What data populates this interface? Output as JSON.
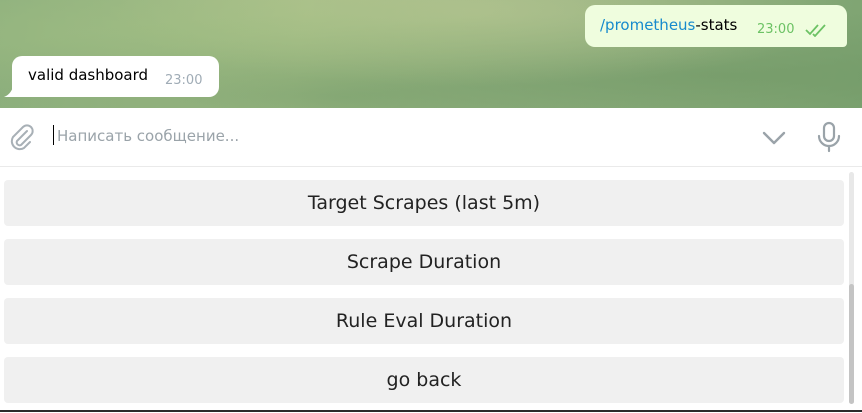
{
  "chat": {
    "outgoing": {
      "command": "/prometheus",
      "suffix": "-stats",
      "time": "23:00",
      "status_icon": "double-check-icon"
    },
    "incoming": {
      "text": "valid dashboard",
      "time": "23:00"
    }
  },
  "composer": {
    "placeholder": "Написать сообщение...",
    "attach_icon": "paperclip-icon",
    "keyboard_toggle_icon": "chevron-down-icon",
    "voice_icon": "microphone-icon"
  },
  "keyboard": {
    "buttons": [
      {
        "label": "Target Scrapes (last 5m)"
      },
      {
        "label": "Scrape Duration"
      },
      {
        "label": "Rule Eval Duration"
      },
      {
        "label": "go back"
      }
    ]
  },
  "colors": {
    "link": "#168acd",
    "outgoing_bubble": "#effdde",
    "outgoing_time": "#6cc264",
    "incoming_time": "#a0acb6",
    "keyboard_button": "#f0f0f0"
  }
}
